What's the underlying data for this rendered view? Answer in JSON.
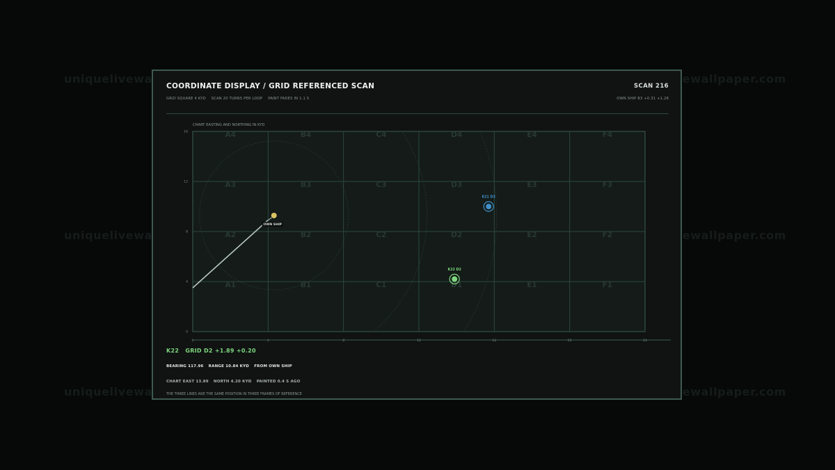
{
  "watermark": "uniquelivewallpaper.com",
  "header": {
    "title": "COORDINATE DISPLAY / GRID REFERENCED SCAN",
    "scan_label": "SCAN 216",
    "info_items": [
      "GRID SQUARE 4 KYD",
      "SCAN 20 TURNS PER LOOP",
      "PAINT FADES IN 1.1 S"
    ],
    "own_ship_readout": "OWN SHIP B3 +0.31 +1.28"
  },
  "chart": {
    "caption": "CHART   EASTING AND NORTHING IN KYD",
    "x_ticks": [
      "0",
      "4",
      "8",
      "12",
      "16",
      "20",
      "24"
    ],
    "y_ticks": [
      "0",
      "4",
      "8",
      "12",
      "16"
    ],
    "columns": [
      "A",
      "B",
      "C",
      "D",
      "E",
      "F"
    ],
    "rows": [
      "4",
      "3",
      "2",
      "1"
    ],
    "grid_labels": [
      [
        "A4",
        "B4",
        "C4",
        "D4",
        "E4",
        "F4"
      ],
      [
        "A3",
        "B3",
        "C3",
        "D3",
        "E3",
        "F3"
      ],
      [
        "A2",
        "B2",
        "C2",
        "D2",
        "E2",
        "F2"
      ],
      [
        "A1",
        "B1",
        "C1",
        "D1",
        "E1",
        "F1"
      ]
    ]
  },
  "chart_data": {
    "type": "scatter",
    "x_range": [
      0,
      24
    ],
    "y_range": [
      0,
      16
    ],
    "grid": true,
    "points": [
      {
        "label": "OWN SHIP",
        "x": 4.31,
        "y": 9.28,
        "color": "#d9c463"
      },
      {
        "label": "K21 D3",
        "x": 15.7,
        "y": 10.0,
        "color": "#3f8fc9"
      },
      {
        "label": "K22 D2",
        "x": 13.89,
        "y": 4.2,
        "color": "#7ed67e"
      }
    ],
    "track_start": {
      "x": 0,
      "y": 3.5
    }
  },
  "readout": {
    "track": "K22",
    "grid": "GRID D2 +1.89 +0.20"
  },
  "bearing_info": [
    "BEARING 117.96",
    "RANGE 10.84 KYD",
    "FROM OWN SHIP"
  ],
  "chart_info": [
    "CHART EAST 13.89",
    "NORTH 4.20 KYD",
    "PAINTED 0.4 S AGO"
  ],
  "footnote": "THE THREE LINES ARE THE SAME POSITION IN THREE FRAMES OF REFERENCE",
  "colors": {
    "accent_green": "#7ed67e",
    "own_ship": "#d9c463",
    "contact_blue": "#3f8fc9",
    "grid_line": "#2c4a40",
    "panel_border": "#3e5a51"
  }
}
